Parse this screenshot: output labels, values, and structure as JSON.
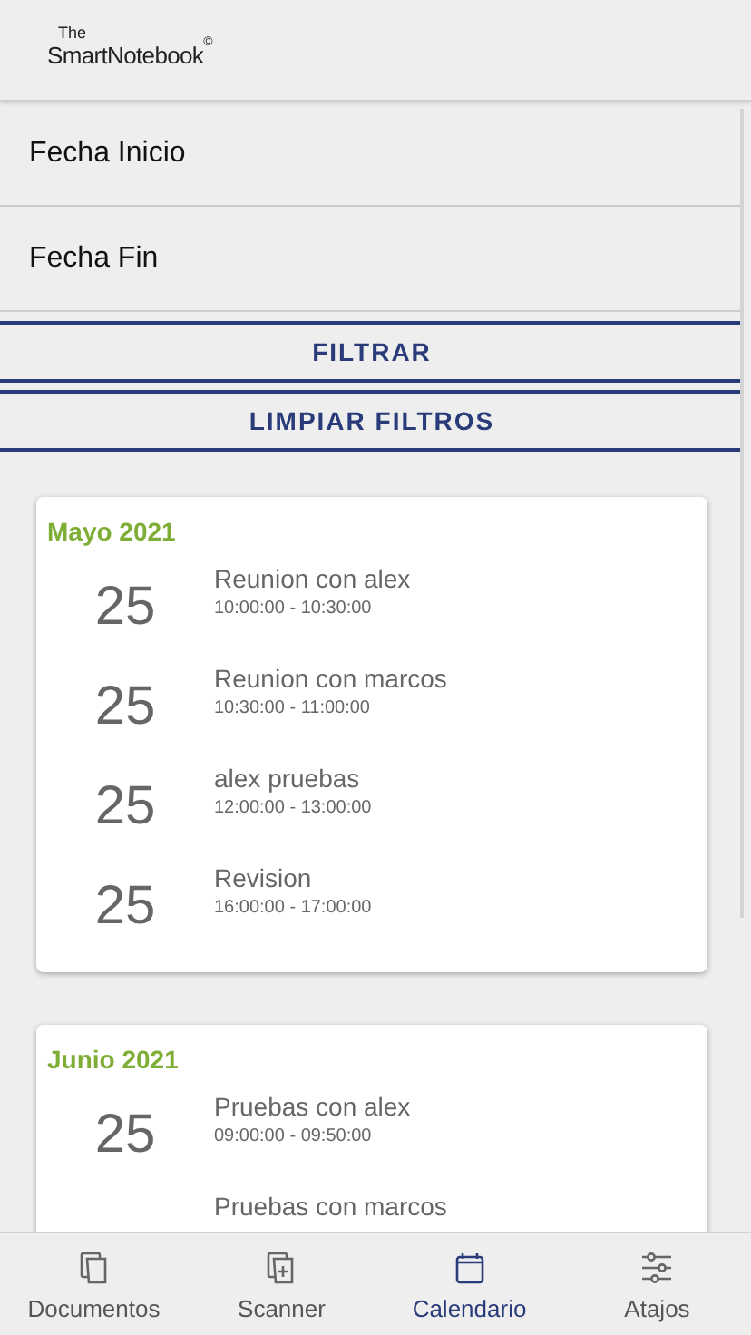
{
  "header": {
    "logo": {
      "small": "The",
      "main": "SmartNotebook",
      "mark": "©"
    }
  },
  "filters": {
    "fields": [
      {
        "placeholder": "Fecha Inicio"
      },
      {
        "placeholder": "Fecha Fin"
      }
    ],
    "buttons": [
      "FILTRAR",
      "LIMPIAR FILTROS"
    ]
  },
  "months": [
    {
      "title": "Mayo 2021",
      "events": [
        {
          "day": "25",
          "title": "Reunion con alex",
          "time": "10:00:00 - 10:30:00"
        },
        {
          "day": "25",
          "title": "Reunion con marcos",
          "time": "10:30:00 - 11:00:00"
        },
        {
          "day": "25",
          "title": "alex pruebas",
          "time": "12:00:00 - 13:00:00"
        },
        {
          "day": "25",
          "title": "Revision",
          "time": "16:00:00 - 17:00:00"
        }
      ]
    },
    {
      "title": "Junio 2021",
      "events": [
        {
          "day": "25",
          "title": "Pruebas con alex",
          "time": "09:00:00 - 09:50:00"
        },
        {
          "title": "Pruebas con marcos"
        }
      ]
    }
  ],
  "tab_bar": [
    {
      "kind": "documents",
      "label": "Documentos",
      "selected": false
    },
    {
      "kind": "scanner",
      "label": "Scanner",
      "selected": false
    },
    {
      "kind": "calendar",
      "label": "Calendario",
      "selected": true
    },
    {
      "kind": "shortcuts",
      "label": "Atajos",
      "selected": false
    }
  ]
}
